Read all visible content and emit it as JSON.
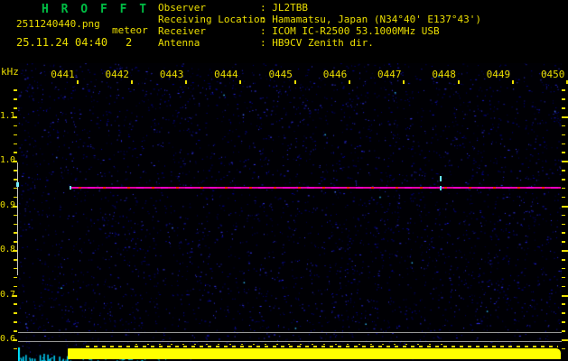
{
  "app": {
    "title": "H R O F F T"
  },
  "capture": {
    "filename": "2511240440.png",
    "mode": "meteor",
    "datetime": "25.11.24 04:40",
    "count": "2"
  },
  "station": {
    "separator": ":",
    "rows": [
      {
        "label": "Observer",
        "value": "JL2TBB"
      },
      {
        "label": "Receiving Location",
        "value": "Hamamatsu, Japan (N34°40' E137°43')"
      },
      {
        "label": "Receiver",
        "value": "ICOM IC-R2500 53.1000MHz USB"
      },
      {
        "label": "Antenna",
        "value": "HB9CV Zenith dir."
      }
    ]
  },
  "chart_data": {
    "type": "heatmap",
    "subtype": "radio-meteor-spectrogram",
    "x_axis": {
      "tick_labels": [
        "0441",
        "0442",
        "0443",
        "0444",
        "0445",
        "0446",
        "0447",
        "0448",
        "0449",
        "0450"
      ]
    },
    "y_axis": {
      "unit_label": "kHz",
      "tick_labels": [
        "1.1",
        "1.0",
        "0.9",
        "0.8",
        "0.7",
        "0.6"
      ],
      "approx_range_khz": [
        0.55,
        1.16
      ],
      "minor_ticks_per_major": 5
    },
    "features": [
      {
        "name": "carrier-line",
        "kind": "horizontal-line",
        "freq_khz": 0.94,
        "time_span": [
          "0441",
          "0450"
        ],
        "color": "#ee00aa"
      },
      {
        "name": "meteor-echo",
        "kind": "point-burst",
        "time": "0448",
        "freq_khz": 0.94,
        "color": "#66ecff"
      },
      {
        "name": "signal-level-strip",
        "kind": "bar-strip",
        "color": "#ffff00"
      },
      {
        "name": "level-scale-lines",
        "kind": "horizontal-gridlines",
        "count": 2,
        "color": "#9a9a9a"
      }
    ],
    "legend": false,
    "grid": false,
    "noise_color": "#0000a0"
  },
  "colors": {
    "title_green": "#00bd44",
    "text_yellow": "#ecdf00",
    "bar_yellow": "#ffff00",
    "carrier_magenta": "#ee00aa",
    "echo_cyan": "#66ecff",
    "scale_gray": "#9a9a9a"
  }
}
